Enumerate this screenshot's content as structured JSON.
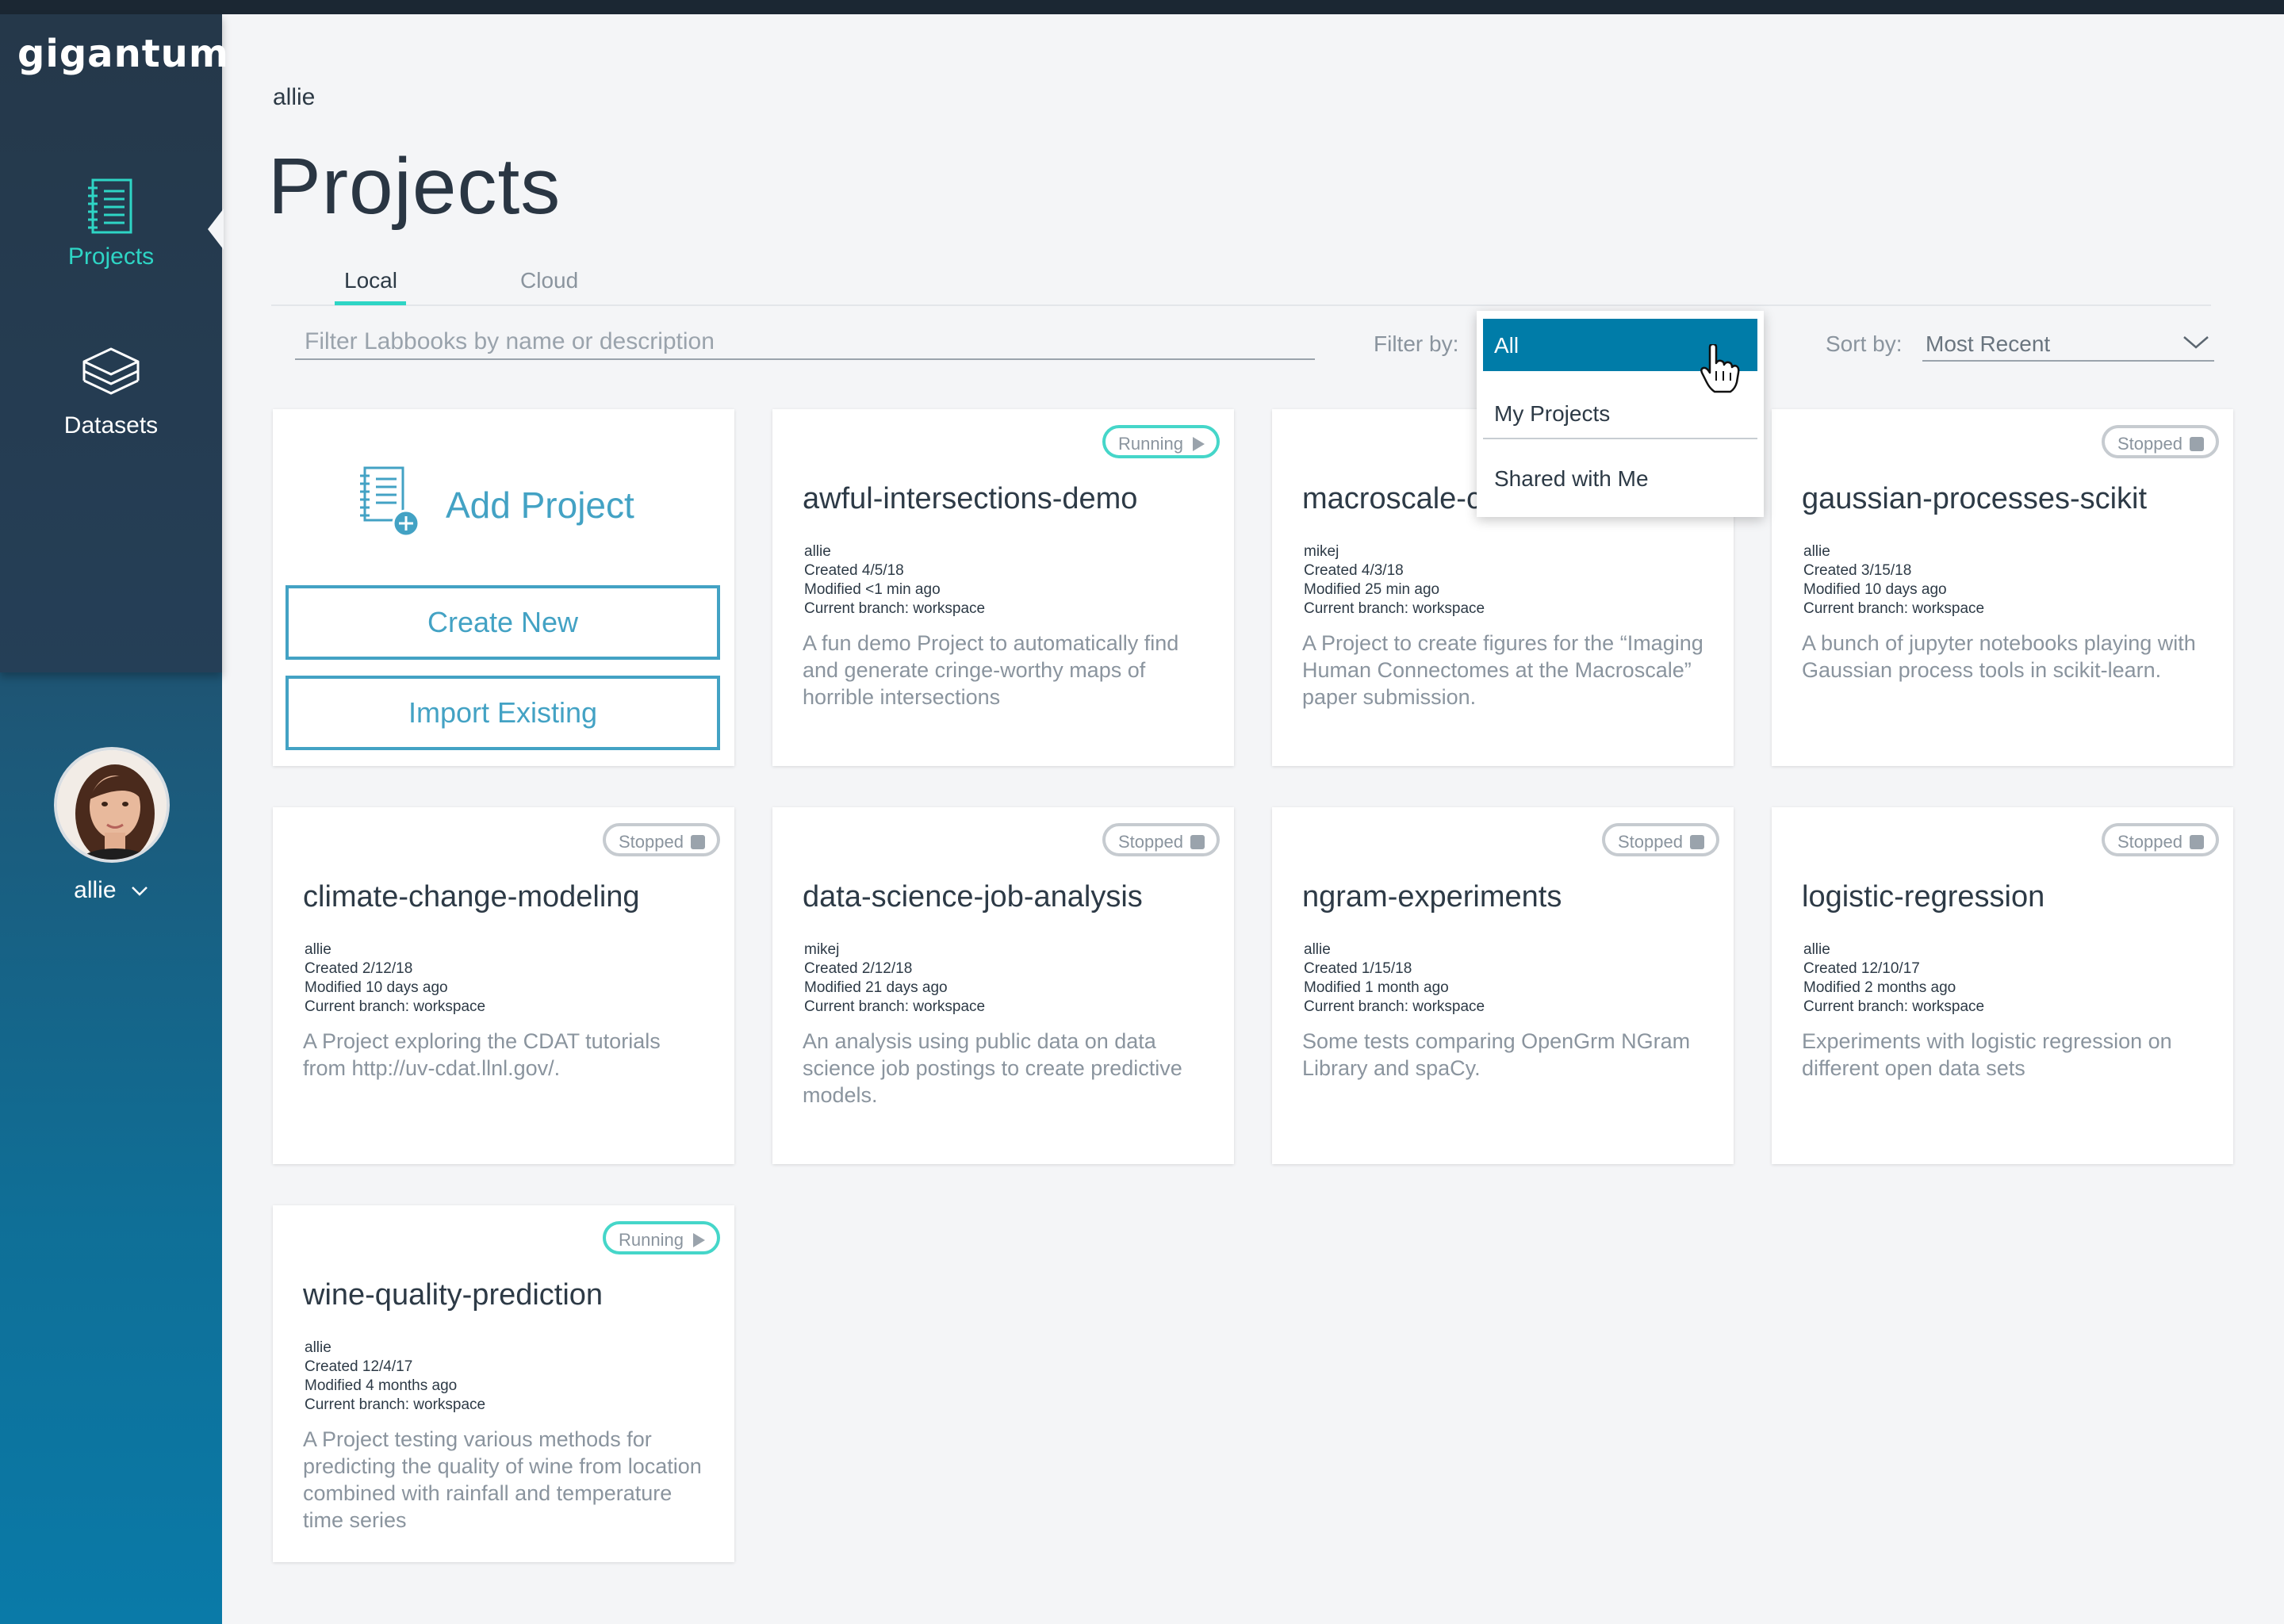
{
  "app": {
    "logo": "gigantum"
  },
  "sidebar": {
    "items": [
      {
        "label": "Projects",
        "icon": "notebook-icon",
        "active": true
      },
      {
        "label": "Datasets",
        "icon": "layers-icon",
        "active": false
      }
    ],
    "user": {
      "name": "allie",
      "menu_icon": "chevron-down-icon"
    }
  },
  "header": {
    "username": "allie",
    "title": "Projects"
  },
  "tabs": [
    {
      "label": "Local",
      "active": true
    },
    {
      "label": "Cloud",
      "active": false
    }
  ],
  "search": {
    "placeholder": "Filter Labbooks by name or description",
    "value": ""
  },
  "filter": {
    "label": "Filter by:",
    "options": [
      {
        "label": "All",
        "selected": true
      },
      {
        "label": "My Projects",
        "selected": false
      },
      {
        "label": "Shared with Me",
        "selected": false
      }
    ]
  },
  "sort": {
    "label": "Sort by:",
    "value": "Most Recent"
  },
  "add_project": {
    "title": "Add Project",
    "create_label": "Create New",
    "import_label": "Import Existing"
  },
  "projects": [
    {
      "title": "awful-intersections-demo",
      "status": "Running",
      "owner": "allie",
      "created": "Created 4/5/18",
      "modified": "Modified <1 min ago",
      "branch": "Current branch: workspace",
      "description": "A fun demo Project to automatically find and generate cringe-worthy maps of horrible intersections"
    },
    {
      "title": "macroscale-c",
      "status": "",
      "owner": "mikej",
      "created": "Created 4/3/18",
      "modified": "Modified 25 min ago",
      "branch": "Current branch: workspace",
      "description": "A Project to create figures for the “Imaging Human Connectomes at the Macroscale” paper submission."
    },
    {
      "title": "gaussian-processes-scikit",
      "status": "Stopped",
      "owner": "allie",
      "created": "Created 3/15/18",
      "modified": "Modified 10 days ago",
      "branch": "Current branch: workspace",
      "description": "A bunch of jupyter notebooks playing with Gaussian process tools in scikit-learn."
    },
    {
      "title": "climate-change-modeling",
      "status": "Stopped",
      "owner": "allie",
      "created": "Created 2/12/18",
      "modified": "Modified 10 days ago",
      "branch": "Current branch: workspace",
      "description": "A Project exploring the CDAT tutorials from http://uv-cdat.llnl.gov/."
    },
    {
      "title": "data-science-job-analysis",
      "status": "Stopped",
      "owner": "mikej",
      "created": "Created 2/12/18",
      "modified": "Modified 21 days ago",
      "branch": "Current branch: workspace",
      "description": "An analysis using public data on data science job postings to create predictive models."
    },
    {
      "title": "ngram-experiments",
      "status": "Stopped",
      "owner": "allie",
      "created": "Created 1/15/18",
      "modified": "Modified 1 month ago",
      "branch": "Current branch: workspace",
      "description": "Some tests comparing OpenGrm NGram Library and spaCy."
    },
    {
      "title": "logistic-regression",
      "status": "Stopped",
      "owner": "allie",
      "created": "Created 12/10/17",
      "modified": "Modified 2 months ago",
      "branch": "Current branch: workspace",
      "description": "Experiments with logistic regression on different open data sets"
    },
    {
      "title": "wine-quality-prediction",
      "status": "Running",
      "owner": "allie",
      "created": "Created 12/4/17",
      "modified": "Modified 4 months ago",
      "branch": "Current branch: workspace",
      "description": "A Project testing various methods for predicting the quality of wine from location combined with rainfall and temperature time series"
    }
  ],
  "colors": {
    "accent": "#2ed5c5",
    "primary": "#43a2c4",
    "selected": "#007ca8",
    "sidebar_top": "#25384a",
    "sidebar_bottom": "#0a7aa8"
  }
}
